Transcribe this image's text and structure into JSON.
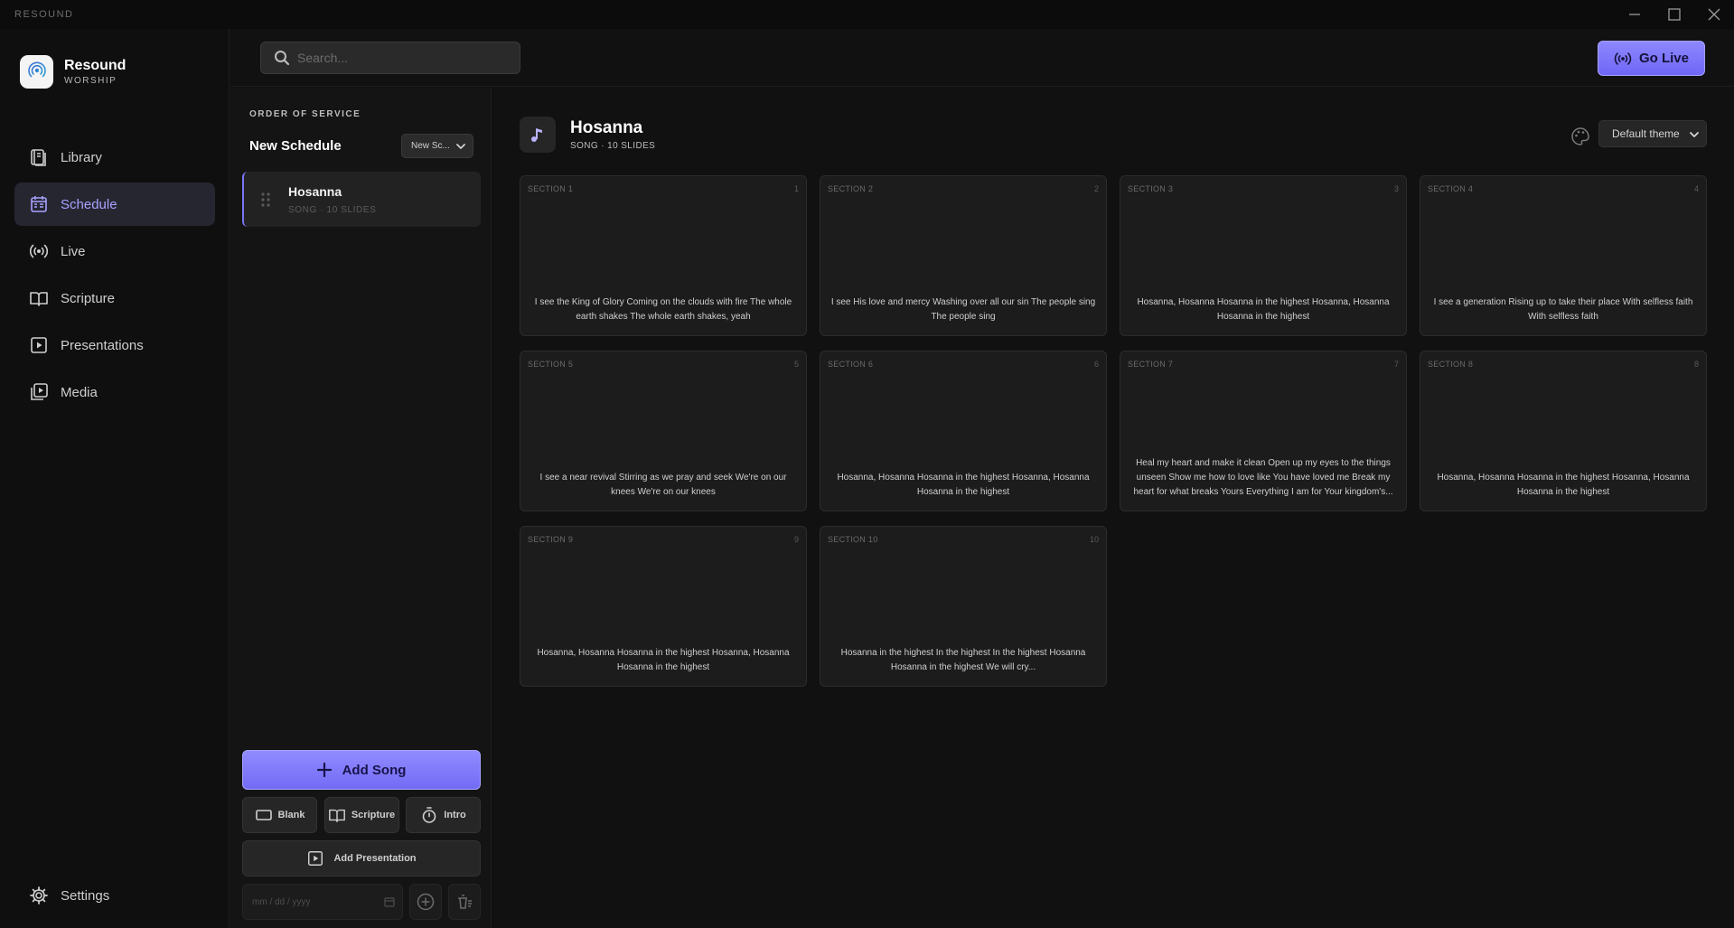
{
  "window": {
    "title": "RESOUND"
  },
  "brand": {
    "name": "Resound",
    "sub": "WORSHIP"
  },
  "nav": {
    "items": [
      {
        "label": "Library",
        "icon": "library-icon"
      },
      {
        "label": "Schedule",
        "icon": "calendar-icon",
        "active": true
      },
      {
        "label": "Live",
        "icon": "broadcast-icon"
      },
      {
        "label": "Scripture",
        "icon": "book-icon"
      },
      {
        "label": "Presentations",
        "icon": "play-square-icon"
      },
      {
        "label": "Media",
        "icon": "media-icon"
      }
    ],
    "settings_label": "Settings"
  },
  "search": {
    "placeholder": "Search...",
    "value": ""
  },
  "topbar": {
    "go_live_label": "Go Live"
  },
  "schedule": {
    "section_label": "ORDER OF SERVICE",
    "name": "New Schedule",
    "select_value": "New Sc...",
    "items": [
      {
        "title": "Hosanna",
        "subtitle": "SONG · 10 SLIDES"
      }
    ],
    "add_song_label": "Add Song",
    "quick": {
      "blank": "Blank",
      "scripture": "Scripture",
      "intro": "Intro"
    },
    "add_presentation_label": "Add Presentation",
    "date_placeholder": "mm / dd / yyyy"
  },
  "song": {
    "title": "Hosanna",
    "meta": "SONG · 10 SLIDES",
    "theme": "Default theme"
  },
  "slides": [
    {
      "section": "SECTION 1",
      "num": "1",
      "lyric": "I see the King of Glory Coming on the clouds with fire The whole earth shakes The whole earth shakes, yeah"
    },
    {
      "section": "SECTION 2",
      "num": "2",
      "lyric": "I see His love and mercy Washing over all our sin The people sing The people sing"
    },
    {
      "section": "SECTION 3",
      "num": "3",
      "lyric": "Hosanna, Hosanna Hosanna in the highest Hosanna, Hosanna Hosanna in the highest"
    },
    {
      "section": "SECTION 4",
      "num": "4",
      "lyric": "I see a generation Rising up to take their place With selfless faith With selfless faith"
    },
    {
      "section": "SECTION 5",
      "num": "5",
      "lyric": "I see a near revival Stirring as we pray and seek We're on our knees We're on our knees"
    },
    {
      "section": "SECTION 6",
      "num": "6",
      "lyric": "Hosanna, Hosanna Hosanna in the highest Hosanna, Hosanna Hosanna in the highest"
    },
    {
      "section": "SECTION 7",
      "num": "7",
      "lyric": "Heal my heart and make it clean Open up my eyes to the things unseen Show me how to love like You have loved me Break my heart for what breaks Yours Everything I am for Your kingdom's..."
    },
    {
      "section": "SECTION 8",
      "num": "8",
      "lyric": "Hosanna, Hosanna Hosanna in the highest Hosanna, Hosanna Hosanna in the highest"
    },
    {
      "section": "SECTION 9",
      "num": "9",
      "lyric": "Hosanna, Hosanna Hosanna in the highest Hosanna, Hosanna Hosanna in the highest"
    },
    {
      "section": "SECTION 10",
      "num": "10",
      "lyric": "Hosanna in the highest In the highest In the highest Hosanna Hosanna in the highest We will cry..."
    }
  ],
  "colors": {
    "accent": "#7b74f7",
    "background": "#111111",
    "panel": "#141414",
    "card": "#1c1c1c"
  }
}
